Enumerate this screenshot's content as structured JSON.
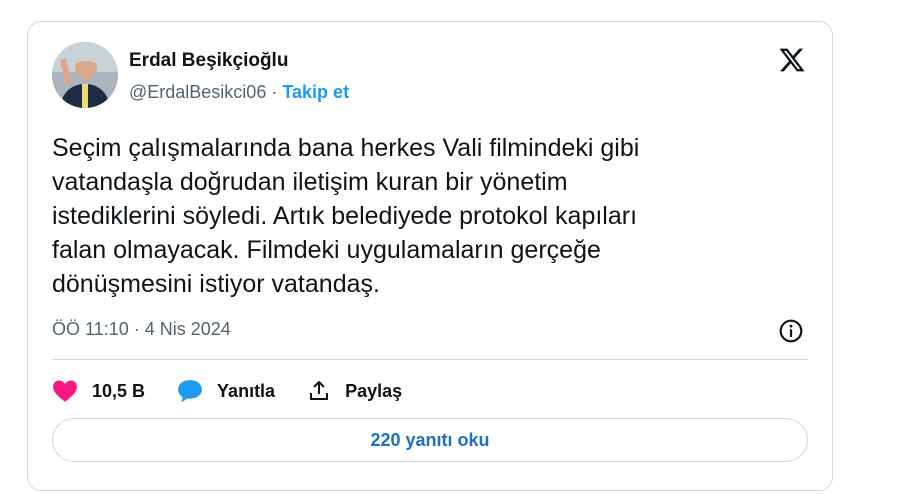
{
  "author": {
    "name": "Erdal Beşikçioğlu",
    "handle": "@ErdalBesikci06",
    "separator": "·",
    "follow_label": "Takip et"
  },
  "tweet": {
    "lines": [
      "Seçim çalışmalarında bana herkes Vali filmindeki gibi",
      "vatandaşla doğrudan iletişim kuran bir yönetim",
      "istediklerini söyledi. Artık belediyede protokol kapıları",
      "falan olmayacak. Filmdeki uygulamaların gerçeğe",
      "dönüşmesini istiyor vatandaş."
    ],
    "timestamp": "ÖÖ 11:10 · 4 Nis 2024"
  },
  "actions": {
    "like_count": "10,5 B",
    "reply_label": "Yanıtla",
    "share_label": "Paylaş"
  },
  "read_replies_label": "220 yanıtı oku",
  "icons": {
    "platform": "x-logo-icon",
    "info": "info-icon",
    "like": "heart-icon",
    "reply": "speech-bubble-icon",
    "share": "share-icon"
  },
  "colors": {
    "like": "#f91880",
    "reply": "#1d9bf0",
    "link": "#1d9bf0",
    "read_replies": "#1d6fc4",
    "border": "#cfd9de",
    "secondary_text": "#536471"
  }
}
